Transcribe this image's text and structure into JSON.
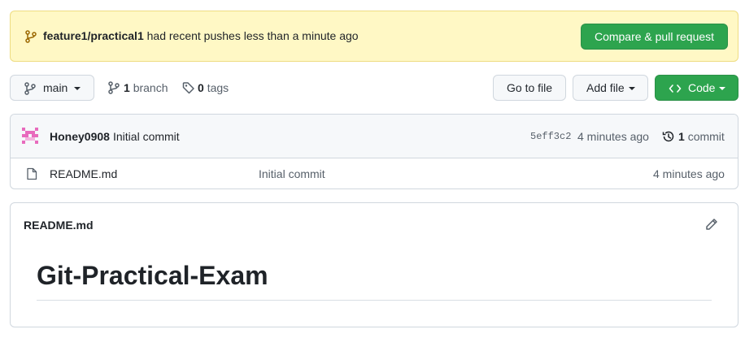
{
  "banner": {
    "branch": "feature1/practical1",
    "message": "had recent pushes less than a minute ago",
    "compare_button": "Compare & pull request"
  },
  "toolbar": {
    "branch_select": "main",
    "branch_count": "1",
    "branch_word": "branch",
    "tag_count": "0",
    "tag_word": "tags",
    "go_to_file": "Go to file",
    "add_file": "Add file",
    "code": "Code"
  },
  "latest_commit": {
    "author": "Honey0908",
    "message": "Initial commit",
    "sha": "5eff3c2",
    "time": "4 minutes ago",
    "commit_count": "1",
    "commit_word": "commit"
  },
  "files": [
    {
      "name": "README.md",
      "commit_message": "Initial commit",
      "time": "4 minutes ago"
    }
  ],
  "readme": {
    "title": "README.md",
    "heading": "Git-Practical-Exam"
  },
  "colors": {
    "banner_bg": "#fff8c5",
    "primary_green": "#2da44e",
    "link_blue": "#0969da",
    "avatar_pink": "#e86bbd"
  },
  "icons": [
    "branch-icon",
    "tag-icon",
    "history-icon",
    "file-icon",
    "pencil-icon",
    "code-icon",
    "avatar-identicon"
  ]
}
